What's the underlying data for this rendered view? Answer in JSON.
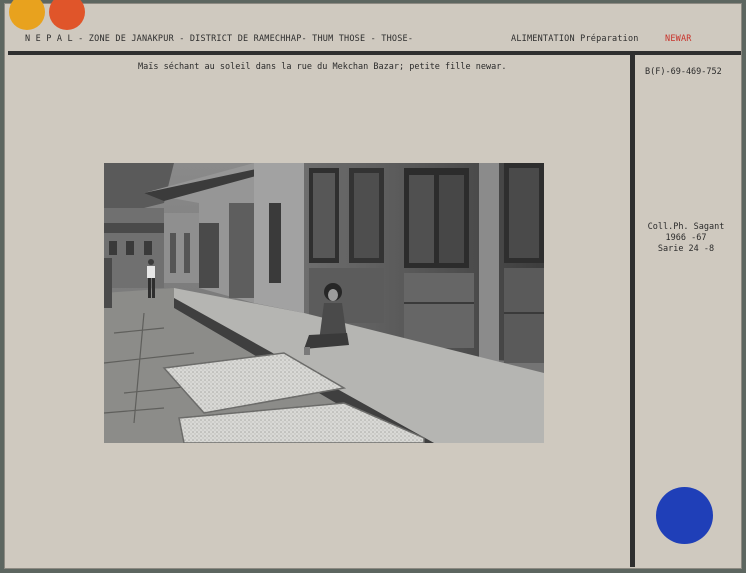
{
  "header": {
    "location": "N E P A L  - ZONE DE JANAKPUR - DISTRICT DE RAMECHHAP- THUM THOSE - THOSE-",
    "category": "ALIMENTATION Préparation",
    "tag": "NEWAR"
  },
  "caption": "Maïs séchant au soleil dans la rue du Mekchan Bazar; petite fille newar.",
  "reference": "B(F)-69-469-752",
  "collection": {
    "line1": "Coll.Ph. Sagant",
    "line2": "1966 -67",
    "line3": "Sarie 24 -8"
  },
  "colors": {
    "dot_yellow": "#e8a21e",
    "dot_orange": "#e0552a",
    "dot_blue": "#1f3fb8",
    "tag_red": "#c8322a"
  }
}
